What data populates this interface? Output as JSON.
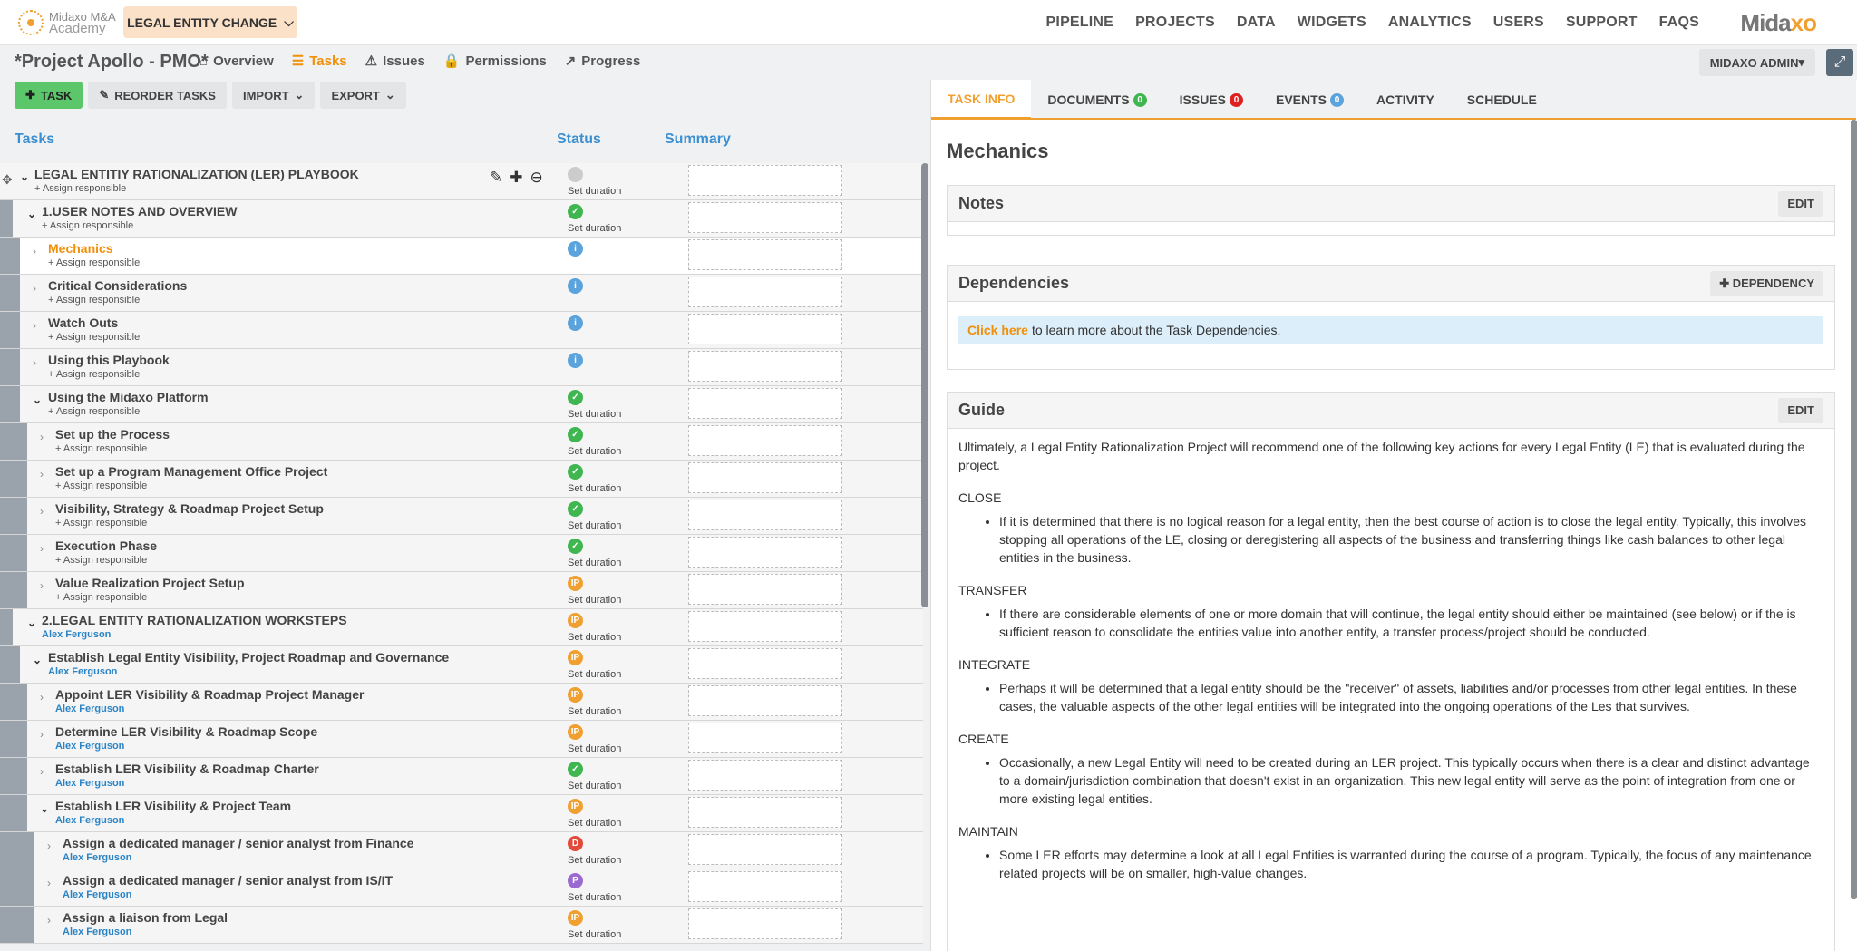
{
  "logo": {
    "line1": "Midaxo M&A",
    "line2": "Academy"
  },
  "entity_button": {
    "label": "LEGAL ENTITY CHANGE"
  },
  "main_nav": [
    "PIPELINE",
    "PROJECTS",
    "DATA",
    "WIDGETS",
    "ANALYTICS",
    "USERS",
    "SUPPORT",
    "FAQS"
  ],
  "brand": {
    "part1": "Mida",
    "part2": "xo"
  },
  "project": {
    "title": "*Project Apollo - PMO*"
  },
  "sub_nav": {
    "overview": "Overview",
    "tasks": "Tasks",
    "issues": "Issues",
    "permissions": "Permissions",
    "progress": "Progress"
  },
  "admin": {
    "label": "MIDAXO ADMIN"
  },
  "toolbar": {
    "task": "TASK",
    "reorder": "REORDER TASKS",
    "import": "IMPORT",
    "export": "EXPORT"
  },
  "columns": {
    "tasks": "Tasks",
    "status": "Status",
    "summary": "Summary"
  },
  "tasks": [
    {
      "name": "LEGAL ENTITIY RATIONALIZATION (LER) PLAYBOOK",
      "resp": "+ Assign responsible",
      "status": "none",
      "duration": "Set duration",
      "level": 0,
      "open": true
    },
    {
      "name": "1.USER NOTES AND OVERVIEW",
      "resp": "+ Assign responsible",
      "status": "done",
      "duration": "Set duration",
      "level": 1,
      "open": true
    },
    {
      "name": "Mechanics",
      "resp": "+ Assign responsible",
      "status": "info",
      "duration": "",
      "level": 2,
      "open": false,
      "selected": true
    },
    {
      "name": "Critical Considerations",
      "resp": "+ Assign responsible",
      "status": "info",
      "duration": "",
      "level": 2,
      "open": false
    },
    {
      "name": "Watch Outs",
      "resp": "+ Assign responsible",
      "status": "info",
      "duration": "",
      "level": 2,
      "open": false
    },
    {
      "name": "Using this Playbook",
      "resp": "+ Assign responsible",
      "status": "info",
      "duration": "",
      "level": 2,
      "open": false
    },
    {
      "name": "Using the Midaxo Platform",
      "resp": "+ Assign responsible",
      "status": "done",
      "duration": "Set duration",
      "level": 2,
      "open": true
    },
    {
      "name": "Set up the Process",
      "resp": "+ Assign responsible",
      "status": "done",
      "duration": "Set duration",
      "level": 3,
      "open": false
    },
    {
      "name": "Set up a Program Management Office Project",
      "resp": "+ Assign responsible",
      "status": "done",
      "duration": "Set duration",
      "level": 3,
      "open": false
    },
    {
      "name": "Visibility, Strategy & Roadmap Project Setup",
      "resp": "+ Assign responsible",
      "status": "done",
      "duration": "Set duration",
      "level": 3,
      "open": false
    },
    {
      "name": "Execution Phase",
      "resp": "+ Assign responsible",
      "status": "done",
      "duration": "Set duration",
      "level": 3,
      "open": false
    },
    {
      "name": "Value Realization Project Setup",
      "resp": "+ Assign responsible",
      "status": "ip",
      "duration": "Set duration",
      "level": 3,
      "open": false
    },
    {
      "name": "2.LEGAL ENTITY RATIONALIZATION WORKSTEPS",
      "resp": "Alex Ferguson",
      "status": "ip",
      "duration": "Set duration",
      "level": 1,
      "open": true,
      "person": true
    },
    {
      "name": "Establish Legal Entity Visibility, Project Roadmap and Governance",
      "resp": "Alex Ferguson",
      "status": "ip",
      "duration": "Set duration",
      "level": 2,
      "open": true,
      "person": true
    },
    {
      "name": "Appoint LER Visibility & Roadmap Project Manager",
      "resp": "Alex Ferguson",
      "status": "ip",
      "duration": "Set duration",
      "level": 3,
      "open": false,
      "person": true
    },
    {
      "name": "Determine LER Visibility & Roadmap Scope",
      "resp": "Alex Ferguson",
      "status": "ip",
      "duration": "Set duration",
      "level": 3,
      "open": false,
      "person": true
    },
    {
      "name": "Establish LER Visibility & Roadmap Charter",
      "resp": "Alex Ferguson",
      "status": "done",
      "duration": "Set duration",
      "level": 3,
      "open": false,
      "person": true
    },
    {
      "name": "Establish LER Visibility & Project Team",
      "resp": "Alex Ferguson",
      "status": "ip",
      "duration": "Set duration",
      "level": 3,
      "open": true,
      "person": true
    },
    {
      "name": "Assign a dedicated manager / senior analyst from Finance",
      "resp": "Alex Ferguson",
      "status": "d",
      "duration": "Set duration",
      "level": 4,
      "open": false,
      "person": true
    },
    {
      "name": "Assign a dedicated manager / senior analyst from IS/IT",
      "resp": "Alex Ferguson",
      "status": "p",
      "duration": "Set duration",
      "level": 4,
      "open": false,
      "person": true
    },
    {
      "name": "Assign a liaison from Legal",
      "resp": "Alex Ferguson",
      "status": "ip",
      "duration": "Set duration",
      "level": 4,
      "open": false,
      "person": true
    }
  ],
  "right_tabs": [
    {
      "label": "TASK INFO",
      "badge": ""
    },
    {
      "label": "DOCUMENTS",
      "badge": "0",
      "color": "#3fb64f"
    },
    {
      "label": "ISSUES",
      "badge": "0",
      "color": "#e02020"
    },
    {
      "label": "EVENTS",
      "badge": "0",
      "color": "#5ba3dc"
    },
    {
      "label": "ACTIVITY",
      "badge": ""
    },
    {
      "label": "SCHEDULE",
      "badge": ""
    }
  ],
  "detail": {
    "title": "Mechanics",
    "notes": {
      "title": "Notes",
      "edit": "EDIT"
    },
    "dependencies": {
      "title": "Dependencies",
      "button": "DEPENDENCY",
      "link": "Click here",
      "text": "to learn more about the Task Dependencies."
    },
    "guide": {
      "title": "Guide",
      "edit": "EDIT",
      "intro": "Ultimately, a Legal Entity Rationalization Project will recommend one of the following key actions for every Legal Entity (LE) that is evaluated during the project.",
      "sections": [
        {
          "heading": "CLOSE",
          "text": "If it is determined that there is no logical reason for a legal entity, then the best course of action is to close the legal entity. Typically, this involves stopping all operations of the LE, closing or deregistering all aspects of the business and transferring things like cash balances to other legal entities in the business."
        },
        {
          "heading": "TRANSFER",
          "text": "If there are considerable elements of one or more domain that will continue, the legal entity should either be maintained (see below) or if the is sufficient reason to consolidate the entities value into another entity, a transfer process/project should be conducted."
        },
        {
          "heading": "INTEGRATE",
          "text": "Perhaps it will be determined that a legal entity should be the \"receiver\" of assets, liabilities and/or processes from other legal entities. In these cases, the valuable aspects of the other legal entities will be integrated into the ongoing operations of the Les that survives."
        },
        {
          "heading": "CREATE",
          "text": "Occasionally, a new Legal Entity will need to be created during an LER project. This typically occurs when there is a clear and distinct advantage to a domain/jurisdiction combination that doesn't exist in an organization. This new legal entity will serve as the point of integration from one or more existing legal entities."
        },
        {
          "heading": "MAINTAIN",
          "text": "Some LER efforts may determine a look at all Legal Entities is warranted during the course of a program. Typically, the focus of any maintenance related projects will be on smaller, high-value changes."
        }
      ]
    }
  }
}
